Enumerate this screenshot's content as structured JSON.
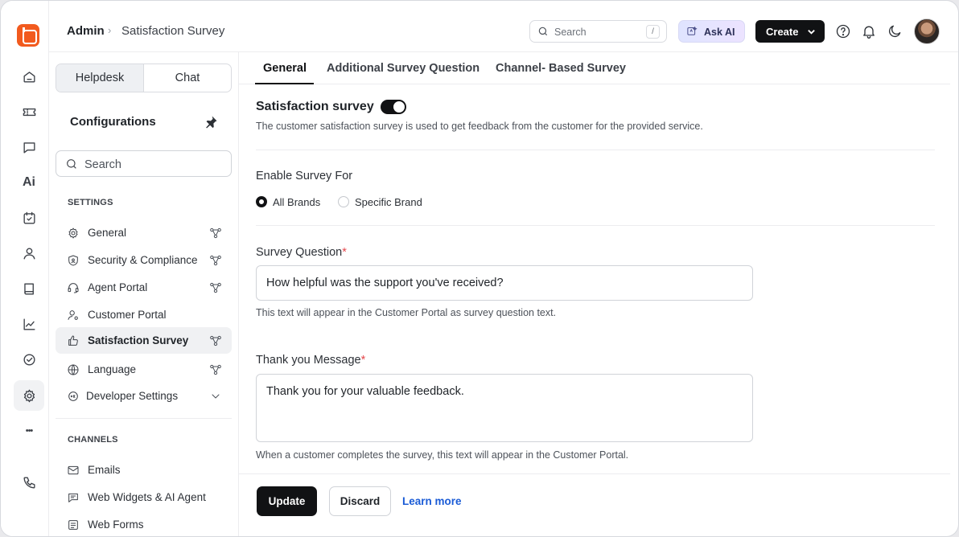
{
  "header": {
    "breadcrumb_root": "Admin",
    "breadcrumb_sep": "›",
    "breadcrumb_page": "Satisfaction Survey",
    "search_placeholder": "Search",
    "search_shortcut": "/",
    "ask_ai_label": "Ask AI",
    "create_label": "Create",
    "icons": [
      "help-icon",
      "bell-icon",
      "moon-icon"
    ]
  },
  "rail": {
    "items": [
      "home-icon",
      "ticket-icon",
      "chat-icon",
      "ai-icon",
      "task-icon",
      "contact-icon",
      "book-icon",
      "analytics-icon",
      "check-icon",
      "settings-icon",
      "more-icon",
      "phone-icon"
    ],
    "ai_text": "Ai",
    "more_text": "•••",
    "active": "settings-icon"
  },
  "sidebar": {
    "segments": [
      "Helpdesk",
      "Chat"
    ],
    "active_segment": "Helpdesk",
    "title": "Configurations",
    "search_placeholder": "Search",
    "settings_label": "SETTINGS",
    "settings_items": [
      {
        "label": "General",
        "icon": "gear-icon",
        "trailing": "graph-icon"
      },
      {
        "label": "Security & Compliance",
        "icon": "shield-icon",
        "trailing": "graph-icon"
      },
      {
        "label": "Agent Portal",
        "icon": "headset-icon",
        "trailing": "graph-icon"
      },
      {
        "label": "Customer Portal",
        "icon": "user-gear-icon",
        "trailing": ""
      },
      {
        "label": "Satisfaction Survey",
        "icon": "thumbs-up-icon",
        "trailing": "graph-icon"
      },
      {
        "label": "Language",
        "icon": "globe-icon",
        "trailing": "graph-icon"
      },
      {
        "label": "Developer Settings",
        "icon": "sdk-icon",
        "trailing": "chevron-down-icon"
      }
    ],
    "active_item": "Satisfaction Survey",
    "channels_label": "CHANNELS",
    "channel_items": [
      {
        "label": "Emails",
        "icon": "mail-icon"
      },
      {
        "label": "Web Widgets & AI Agent",
        "icon": "widget-icon"
      },
      {
        "label": "Web Forms",
        "icon": "form-icon"
      }
    ]
  },
  "tabs": [
    "General",
    "Additional Survey Question",
    "Channel- Based Survey"
  ],
  "active_tab": "General",
  "main": {
    "title": "Satisfaction survey",
    "toggle_on": true,
    "description": "The customer satisfaction survey is used to get feedback from the customer for the provided service.",
    "enable_label": "Enable Survey For",
    "radio_options": [
      "All Brands",
      "Specific Brand"
    ],
    "radio_selected": "All Brands",
    "question_label": "Survey Question",
    "question_required": "*",
    "question_value": "How helpful was the support you've received?",
    "question_help": "This text will appear in the Customer Portal as survey question text.",
    "thanks_label": "Thank you Message",
    "thanks_required": "*",
    "thanks_value": "Thank you for your valuable feedback.",
    "thanks_help": "When a customer completes the survey, this text will appear in the Customer Portal."
  },
  "footer": {
    "update_label": "Update",
    "discard_label": "Discard",
    "learn_more_label": "Learn more"
  },
  "colors": {
    "brand": "#f25a1e",
    "primary_button": "#111214",
    "link": "#1a5bd6",
    "required": "#e5484d"
  }
}
